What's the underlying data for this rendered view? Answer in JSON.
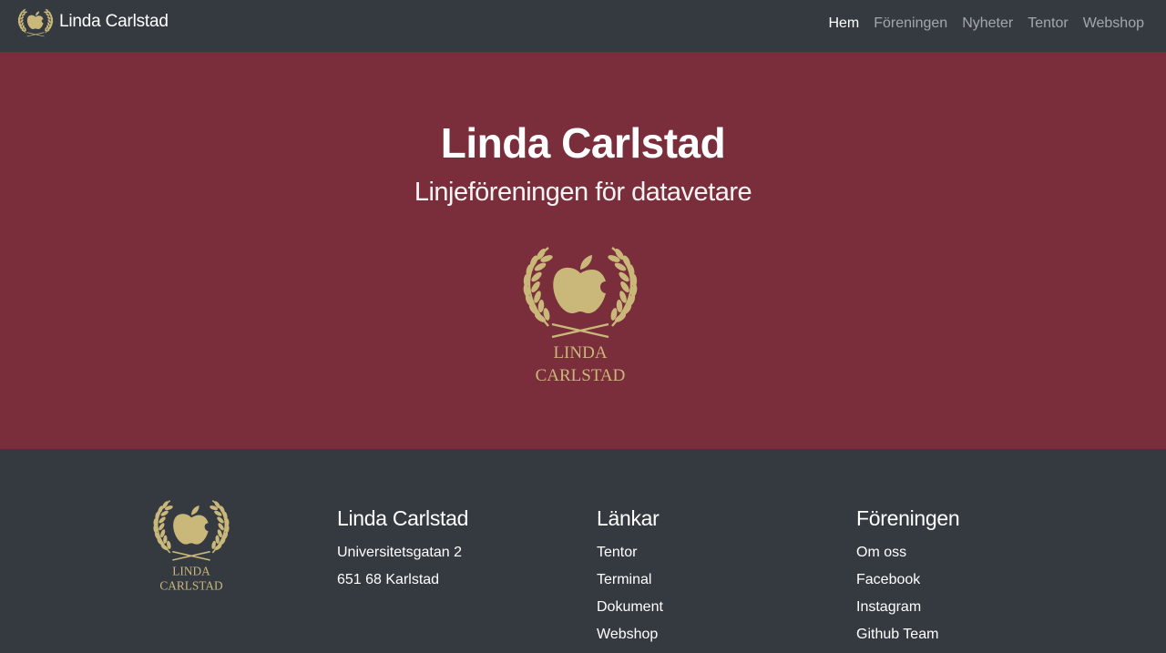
{
  "colors": {
    "navbar": "#343a40",
    "hero": "#7a2d3a",
    "gold": "#c9b87a",
    "text": "#ffffff"
  },
  "navbar": {
    "brand": "Linda Carlstad",
    "brand_icon": "laurel-apple-logo-icon",
    "items": [
      {
        "label": "Hem",
        "active": true
      },
      {
        "label": "Föreningen",
        "active": false
      },
      {
        "label": "Nyheter",
        "active": false
      },
      {
        "label": "Tentor",
        "active": false
      },
      {
        "label": "Webshop",
        "active": false
      }
    ]
  },
  "hero": {
    "title": "Linda Carlstad",
    "subtitle": "Linjeföreningen för datavetare",
    "emblem_line1": "LINDA",
    "emblem_line2": "CARLSTAD"
  },
  "footer": {
    "logo_line1": "LINDA",
    "logo_line2": "CARLSTAD",
    "contact": {
      "heading": "Linda Carlstad",
      "lines": [
        "Universitetsgatan 2",
        "651 68 Karlstad"
      ]
    },
    "links": {
      "heading": "Länkar",
      "items": [
        "Tentor",
        "Terminal",
        "Dokument",
        "Webshop"
      ]
    },
    "association": {
      "heading": "Föreningen",
      "items": [
        "Om oss",
        "Facebook",
        "Instagram",
        "Github Team"
      ]
    }
  }
}
